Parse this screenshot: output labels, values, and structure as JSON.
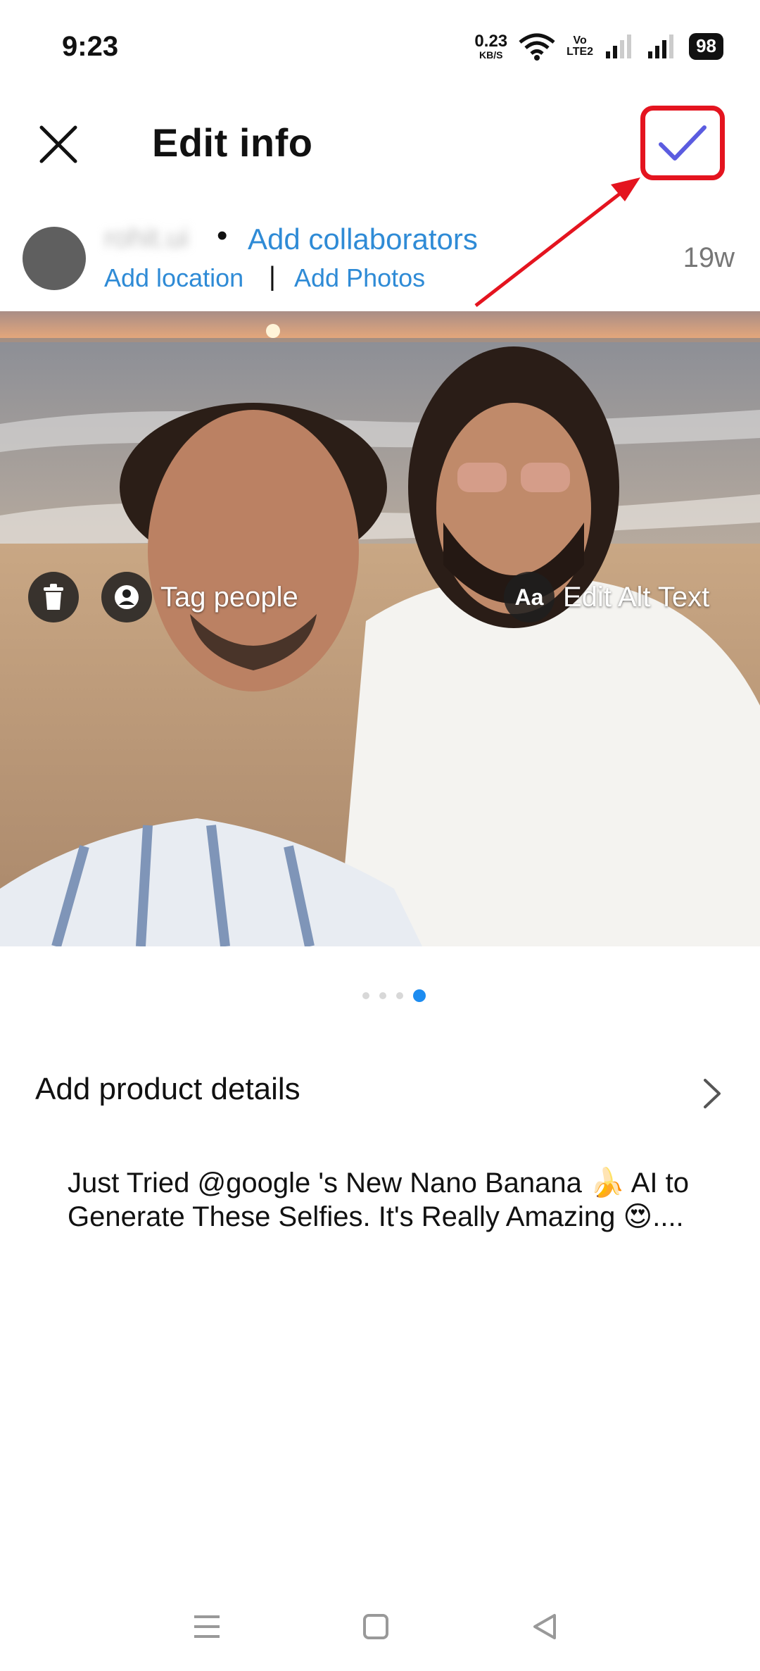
{
  "status_bar": {
    "time": "9:23",
    "net_speed_value": "0.23",
    "net_speed_unit": "KB/S",
    "volte_top": "Vo",
    "volte_bottom": "LTE2",
    "battery": "98"
  },
  "header": {
    "title": "Edit info"
  },
  "author": {
    "username": "rohit.ui",
    "separator": "•",
    "add_collaborators": "Add collaborators",
    "add_location": "Add location",
    "divider": "|",
    "add_photos": "Add Photos",
    "post_age": "19w"
  },
  "photo": {
    "tag_people": "Tag people",
    "alt_icon": "Aa",
    "edit_alt_text": "Edit Alt Text"
  },
  "carousel": {
    "count": 4,
    "active_index": 3
  },
  "product": {
    "label": "Add product details"
  },
  "caption": {
    "text": "Just Tried @google 's New Nano Banana 🍌 AI to Generate These Selfies. It's Really Amazing 😍...."
  },
  "colors": {
    "link_blue": "#2f8bd6",
    "confirm_check": "#5b5ce0",
    "highlight_red": "#e4141f",
    "active_dot": "#1d8cf0"
  },
  "icons": [
    "close-icon",
    "checkmark-icon",
    "trash-icon",
    "user-tag-icon",
    "chevron-right-icon",
    "menu-icon",
    "home-icon",
    "back-icon"
  ]
}
